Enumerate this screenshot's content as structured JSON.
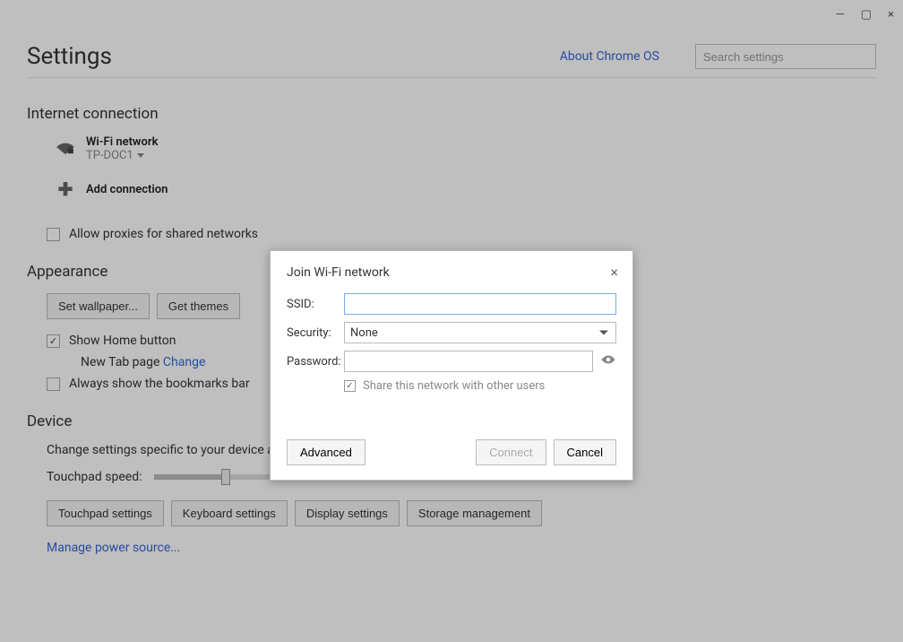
{
  "window": {
    "minimize": "—",
    "maximize": "▢",
    "close": "×"
  },
  "header": {
    "title": "Settings",
    "about": "About Chrome OS",
    "search_placeholder": "Search settings"
  },
  "internet": {
    "section": "Internet connection",
    "wifi_label": "Wi-Fi network",
    "wifi_ssid": "TP-DOC1",
    "add_connection": "Add connection",
    "allow_proxies": "Allow proxies for shared networks"
  },
  "appearance": {
    "section": "Appearance",
    "set_wallpaper": "Set wallpaper...",
    "get_themes": "Get themes",
    "show_home": "Show Home button",
    "new_tab": "New Tab page",
    "change": "Change",
    "always_show_bookmarks": "Always show the bookmarks bar"
  },
  "device": {
    "section": "Device",
    "description": "Change settings specific to your device and peripherals.",
    "touchpad_speed_label": "Touchpad speed:",
    "touchpad_settings": "Touchpad settings",
    "keyboard_settings": "Keyboard settings",
    "display_settings": "Display settings",
    "storage_management": "Storage management",
    "manage_power": "Manage power source..."
  },
  "dialog": {
    "title": "Join Wi-Fi network",
    "ssid_label": "SSID:",
    "ssid_value": "",
    "security_label": "Security:",
    "security_value": "None",
    "password_label": "Password:",
    "password_value": "",
    "share_label": "Share this network with other users",
    "advanced": "Advanced",
    "connect": "Connect",
    "cancel": "Cancel"
  }
}
